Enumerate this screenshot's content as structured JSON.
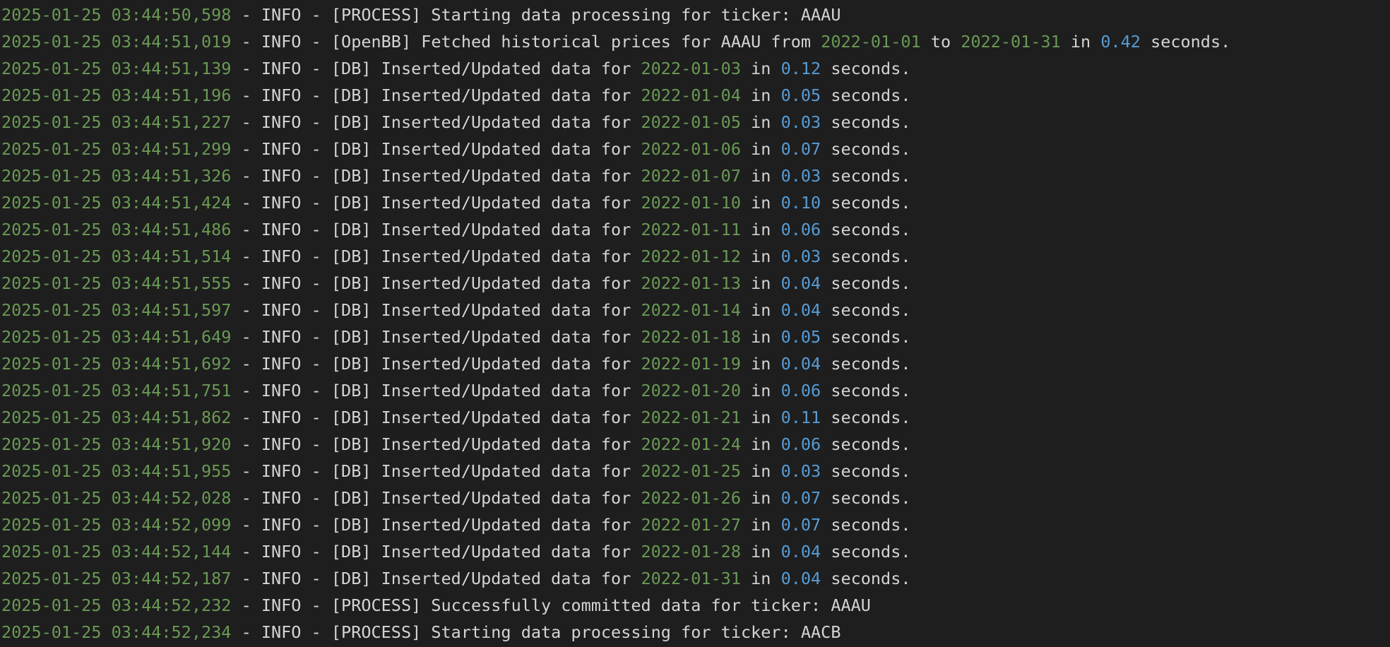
{
  "colors": {
    "background": "#1e1e1e",
    "text": "#d4d4d4",
    "timestamp": "#6a9955",
    "date": "#6a9955",
    "number": "#569cd6"
  },
  "lines": [
    [
      {
        "t": "2025-01-25 03:44:50,598",
        "c": "ts"
      },
      {
        "t": " - INFO - [PROCESS] Starting data processing for ticker: AAAU",
        "c": "txt"
      }
    ],
    [
      {
        "t": "2025-01-25 03:44:51,019",
        "c": "ts"
      },
      {
        "t": " - INFO - [OpenBB] Fetched historical prices for AAAU from ",
        "c": "txt"
      },
      {
        "t": "2022-01-01",
        "c": "date"
      },
      {
        "t": " to ",
        "c": "txt"
      },
      {
        "t": "2022-01-31",
        "c": "date"
      },
      {
        "t": " in ",
        "c": "txt"
      },
      {
        "t": "0.42",
        "c": "num"
      },
      {
        "t": " seconds.",
        "c": "txt"
      }
    ],
    [
      {
        "t": "2025-01-25 03:44:51,139",
        "c": "ts"
      },
      {
        "t": " - INFO - [DB] Inserted/Updated data for ",
        "c": "txt"
      },
      {
        "t": "2022-01-03",
        "c": "date"
      },
      {
        "t": " in ",
        "c": "txt"
      },
      {
        "t": "0.12",
        "c": "num"
      },
      {
        "t": " seconds.",
        "c": "txt"
      }
    ],
    [
      {
        "t": "2025-01-25 03:44:51,196",
        "c": "ts"
      },
      {
        "t": " - INFO - [DB] Inserted/Updated data for ",
        "c": "txt"
      },
      {
        "t": "2022-01-04",
        "c": "date"
      },
      {
        "t": " in ",
        "c": "txt"
      },
      {
        "t": "0.05",
        "c": "num"
      },
      {
        "t": " seconds.",
        "c": "txt"
      }
    ],
    [
      {
        "t": "2025-01-25 03:44:51,227",
        "c": "ts"
      },
      {
        "t": " - INFO - [DB] Inserted/Updated data for ",
        "c": "txt"
      },
      {
        "t": "2022-01-05",
        "c": "date"
      },
      {
        "t": " in ",
        "c": "txt"
      },
      {
        "t": "0.03",
        "c": "num"
      },
      {
        "t": " seconds.",
        "c": "txt"
      }
    ],
    [
      {
        "t": "2025-01-25 03:44:51,299",
        "c": "ts"
      },
      {
        "t": " - INFO - [DB] Inserted/Updated data for ",
        "c": "txt"
      },
      {
        "t": "2022-01-06",
        "c": "date"
      },
      {
        "t": " in ",
        "c": "txt"
      },
      {
        "t": "0.07",
        "c": "num"
      },
      {
        "t": " seconds.",
        "c": "txt"
      }
    ],
    [
      {
        "t": "2025-01-25 03:44:51,326",
        "c": "ts"
      },
      {
        "t": " - INFO - [DB] Inserted/Updated data for ",
        "c": "txt"
      },
      {
        "t": "2022-01-07",
        "c": "date"
      },
      {
        "t": " in ",
        "c": "txt"
      },
      {
        "t": "0.03",
        "c": "num"
      },
      {
        "t": " seconds.",
        "c": "txt"
      }
    ],
    [
      {
        "t": "2025-01-25 03:44:51,424",
        "c": "ts"
      },
      {
        "t": " - INFO - [DB] Inserted/Updated data for ",
        "c": "txt"
      },
      {
        "t": "2022-01-10",
        "c": "date"
      },
      {
        "t": " in ",
        "c": "txt"
      },
      {
        "t": "0.10",
        "c": "num"
      },
      {
        "t": " seconds.",
        "c": "txt"
      }
    ],
    [
      {
        "t": "2025-01-25 03:44:51,486",
        "c": "ts"
      },
      {
        "t": " - INFO - [DB] Inserted/Updated data for ",
        "c": "txt"
      },
      {
        "t": "2022-01-11",
        "c": "date"
      },
      {
        "t": " in ",
        "c": "txt"
      },
      {
        "t": "0.06",
        "c": "num"
      },
      {
        "t": " seconds.",
        "c": "txt"
      }
    ],
    [
      {
        "t": "2025-01-25 03:44:51,514",
        "c": "ts"
      },
      {
        "t": " - INFO - [DB] Inserted/Updated data for ",
        "c": "txt"
      },
      {
        "t": "2022-01-12",
        "c": "date"
      },
      {
        "t": " in ",
        "c": "txt"
      },
      {
        "t": "0.03",
        "c": "num"
      },
      {
        "t": " seconds.",
        "c": "txt"
      }
    ],
    [
      {
        "t": "2025-01-25 03:44:51,555",
        "c": "ts"
      },
      {
        "t": " - INFO - [DB] Inserted/Updated data for ",
        "c": "txt"
      },
      {
        "t": "2022-01-13",
        "c": "date"
      },
      {
        "t": " in ",
        "c": "txt"
      },
      {
        "t": "0.04",
        "c": "num"
      },
      {
        "t": " seconds.",
        "c": "txt"
      }
    ],
    [
      {
        "t": "2025-01-25 03:44:51,597",
        "c": "ts"
      },
      {
        "t": " - INFO - [DB] Inserted/Updated data for ",
        "c": "txt"
      },
      {
        "t": "2022-01-14",
        "c": "date"
      },
      {
        "t": " in ",
        "c": "txt"
      },
      {
        "t": "0.04",
        "c": "num"
      },
      {
        "t": " seconds.",
        "c": "txt"
      }
    ],
    [
      {
        "t": "2025-01-25 03:44:51,649",
        "c": "ts"
      },
      {
        "t": " - INFO - [DB] Inserted/Updated data for ",
        "c": "txt"
      },
      {
        "t": "2022-01-18",
        "c": "date"
      },
      {
        "t": " in ",
        "c": "txt"
      },
      {
        "t": "0.05",
        "c": "num"
      },
      {
        "t": " seconds.",
        "c": "txt"
      }
    ],
    [
      {
        "t": "2025-01-25 03:44:51,692",
        "c": "ts"
      },
      {
        "t": " - INFO - [DB] Inserted/Updated data for ",
        "c": "txt"
      },
      {
        "t": "2022-01-19",
        "c": "date"
      },
      {
        "t": " in ",
        "c": "txt"
      },
      {
        "t": "0.04",
        "c": "num"
      },
      {
        "t": " seconds.",
        "c": "txt"
      }
    ],
    [
      {
        "t": "2025-01-25 03:44:51,751",
        "c": "ts"
      },
      {
        "t": " - INFO - [DB] Inserted/Updated data for ",
        "c": "txt"
      },
      {
        "t": "2022-01-20",
        "c": "date"
      },
      {
        "t": " in ",
        "c": "txt"
      },
      {
        "t": "0.06",
        "c": "num"
      },
      {
        "t": " seconds.",
        "c": "txt"
      }
    ],
    [
      {
        "t": "2025-01-25 03:44:51,862",
        "c": "ts"
      },
      {
        "t": " - INFO - [DB] Inserted/Updated data for ",
        "c": "txt"
      },
      {
        "t": "2022-01-21",
        "c": "date"
      },
      {
        "t": " in ",
        "c": "txt"
      },
      {
        "t": "0.11",
        "c": "num"
      },
      {
        "t": " seconds.",
        "c": "txt"
      }
    ],
    [
      {
        "t": "2025-01-25 03:44:51,920",
        "c": "ts"
      },
      {
        "t": " - INFO - [DB] Inserted/Updated data for ",
        "c": "txt"
      },
      {
        "t": "2022-01-24",
        "c": "date"
      },
      {
        "t": " in ",
        "c": "txt"
      },
      {
        "t": "0.06",
        "c": "num"
      },
      {
        "t": " seconds.",
        "c": "txt"
      }
    ],
    [
      {
        "t": "2025-01-25 03:44:51,955",
        "c": "ts"
      },
      {
        "t": " - INFO - [DB] Inserted/Updated data for ",
        "c": "txt"
      },
      {
        "t": "2022-01-25",
        "c": "date"
      },
      {
        "t": " in ",
        "c": "txt"
      },
      {
        "t": "0.03",
        "c": "num"
      },
      {
        "t": " seconds.",
        "c": "txt"
      }
    ],
    [
      {
        "t": "2025-01-25 03:44:52,028",
        "c": "ts"
      },
      {
        "t": " - INFO - [DB] Inserted/Updated data for ",
        "c": "txt"
      },
      {
        "t": "2022-01-26",
        "c": "date"
      },
      {
        "t": " in ",
        "c": "txt"
      },
      {
        "t": "0.07",
        "c": "num"
      },
      {
        "t": " seconds.",
        "c": "txt"
      }
    ],
    [
      {
        "t": "2025-01-25 03:44:52,099",
        "c": "ts"
      },
      {
        "t": " - INFO - [DB] Inserted/Updated data for ",
        "c": "txt"
      },
      {
        "t": "2022-01-27",
        "c": "date"
      },
      {
        "t": " in ",
        "c": "txt"
      },
      {
        "t": "0.07",
        "c": "num"
      },
      {
        "t": " seconds.",
        "c": "txt"
      }
    ],
    [
      {
        "t": "2025-01-25 03:44:52,144",
        "c": "ts"
      },
      {
        "t": " - INFO - [DB] Inserted/Updated data for ",
        "c": "txt"
      },
      {
        "t": "2022-01-28",
        "c": "date"
      },
      {
        "t": " in ",
        "c": "txt"
      },
      {
        "t": "0.04",
        "c": "num"
      },
      {
        "t": " seconds.",
        "c": "txt"
      }
    ],
    [
      {
        "t": "2025-01-25 03:44:52,187",
        "c": "ts"
      },
      {
        "t": " - INFO - [DB] Inserted/Updated data for ",
        "c": "txt"
      },
      {
        "t": "2022-01-31",
        "c": "date"
      },
      {
        "t": " in ",
        "c": "txt"
      },
      {
        "t": "0.04",
        "c": "num"
      },
      {
        "t": " seconds.",
        "c": "txt"
      }
    ],
    [
      {
        "t": "2025-01-25 03:44:52,232",
        "c": "ts"
      },
      {
        "t": " - INFO - [PROCESS] Successfully committed data for ticker: AAAU",
        "c": "txt"
      }
    ],
    [
      {
        "t": "2025-01-25 03:44:52,234",
        "c": "ts"
      },
      {
        "t": " - INFO - [PROCESS] Starting data processing for ticker: AACB",
        "c": "txt"
      }
    ]
  ]
}
